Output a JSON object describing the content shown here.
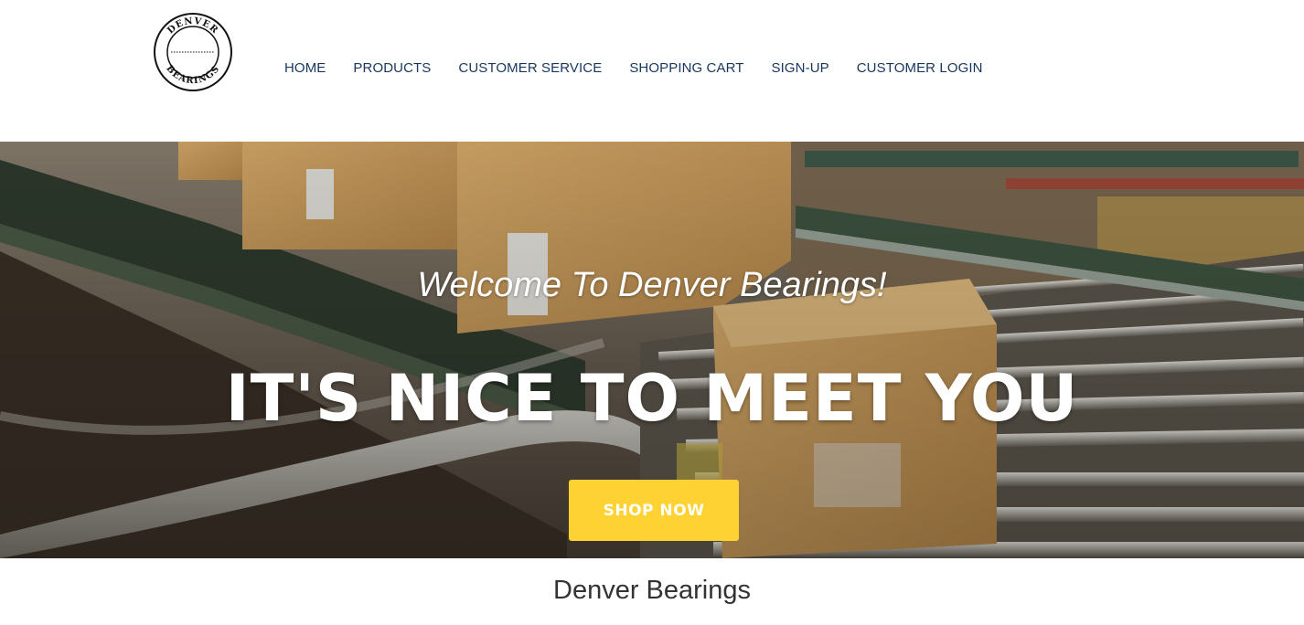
{
  "logo": {
    "top_text": "DENVER",
    "bottom_text": "BEARINGS",
    "icon": "seal-logo-icon"
  },
  "nav": {
    "items": [
      {
        "label": "HOME"
      },
      {
        "label": "PRODUCTS"
      },
      {
        "label": "CUSTOMER SERVICE"
      },
      {
        "label": "SHOPPING CART"
      },
      {
        "label": "SIGN-UP"
      },
      {
        "label": "CUSTOMER LOGIN"
      }
    ]
  },
  "hero": {
    "subheading": "Welcome To Denver Bearings!",
    "heading": "IT'S NICE TO MEET YOU",
    "button_label": "SHOP NOW",
    "background": "warehouse-conveyor-photo"
  },
  "footer": {
    "title": "Denver Bearings"
  },
  "colors": {
    "nav_text": "#17375e",
    "accent": "#fdd232",
    "footer_text": "#333333"
  }
}
